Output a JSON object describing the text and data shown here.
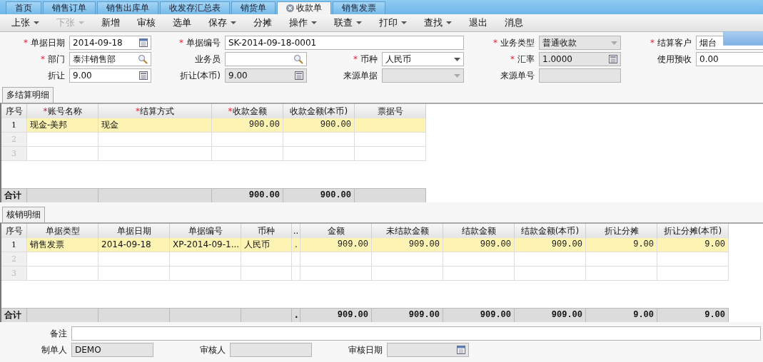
{
  "doc_tabs": [
    {
      "label": "首页",
      "selected": false
    },
    {
      "label": "销售订单",
      "selected": false
    },
    {
      "label": "销售出库单",
      "selected": false
    },
    {
      "label": "收发存汇总表",
      "selected": false
    },
    {
      "label": "销货单",
      "selected": false
    },
    {
      "label": "收款单",
      "selected": true
    },
    {
      "label": "销售发票",
      "selected": false
    }
  ],
  "toolbar": [
    {
      "label": "上张",
      "menu": true,
      "disabled": false
    },
    {
      "label": "下张",
      "menu": true,
      "disabled": true
    },
    {
      "label": "新增",
      "menu": false,
      "disabled": false
    },
    {
      "label": "审核",
      "menu": false,
      "disabled": false
    },
    {
      "label": "选单",
      "menu": false,
      "disabled": false
    },
    {
      "label": "保存",
      "menu": true,
      "disabled": false
    },
    {
      "label": "分摊",
      "menu": false,
      "disabled": false
    },
    {
      "label": "操作",
      "menu": true,
      "disabled": false
    },
    {
      "label": "联查",
      "menu": true,
      "disabled": false
    },
    {
      "label": "打印",
      "menu": true,
      "disabled": false
    },
    {
      "label": "查找",
      "menu": true,
      "disabled": false
    },
    {
      "label": "退出",
      "menu": false,
      "disabled": false
    },
    {
      "label": "消息",
      "menu": false,
      "disabled": false
    }
  ],
  "form": [
    {
      "mark": "*",
      "label": "单据日期",
      "kind": "date",
      "value": "2014-09-18",
      "disabled": false,
      "wide": false
    },
    {
      "mark": "*",
      "label": "单据编号",
      "kind": "plain",
      "value": "SK-2014-09-18-0001",
      "disabled": false,
      "wide": true
    },
    {
      "mark": "*",
      "label": "业务类型",
      "kind": "dropdown",
      "value": "普通收款",
      "disabled": true,
      "wide": false
    },
    {
      "mark": "*",
      "label": "结算客户",
      "kind": "covered",
      "value": "烟台",
      "disabled": false,
      "wide": false
    },
    {
      "mark": "*",
      "label": "部门",
      "kind": "search",
      "value": "泰沣销售部",
      "disabled": false,
      "wide": false
    },
    {
      "label": "业务员",
      "kind": "search",
      "disabled": false,
      "wide": false
    },
    {
      "mark": "*",
      "label": "币种",
      "kind": "dropdown",
      "value": "人民币",
      "disabled": false,
      "wide": false
    },
    {
      "mark": "*",
      "label": "汇率",
      "kind": "calc",
      "value": "1.0000",
      "disabled": true,
      "wide": false
    },
    {
      "label": "使用预收",
      "kind": "plain",
      "value": "0.00",
      "disabled": false,
      "wide": false
    },
    {
      "label": "折让",
      "kind": "calc",
      "value": "9.00",
      "disabled": false,
      "wide": false
    },
    {
      "label": "折让(本币)",
      "kind": "calc",
      "value": "9.00",
      "disabled": true,
      "wide": false
    },
    {
      "label": "来源单据",
      "kind": "dropdown",
      "disabled": true,
      "wide": false
    },
    {
      "label": "来源单号",
      "kind": "plain",
      "disabled": true,
      "wide": false
    }
  ],
  "grids": [
    {
      "tab": "多结算明细",
      "columns": [
        {
          "label": "序号"
        },
        {
          "mark": "*",
          "label": "账号名称"
        },
        {
          "mark": "*",
          "label": "结算方式"
        },
        {
          "mark": "*",
          "label": "收款金额"
        },
        {
          "label": "收款金额(本币)"
        },
        {
          "label": "票据号"
        }
      ],
      "rows": [
        {
          "cells": [
            "1",
            "现金-美邦",
            "现金",
            "900.00",
            "900.00"
          ],
          "selected": true
        },
        {
          "cells": [
            "2"
          ],
          "selected": false
        },
        {
          "cells": [
            "3"
          ],
          "selected": false
        },
        {
          "kind": "total",
          "cells": [
            "合计",
            null,
            null,
            "900.00",
            "900.00"
          ]
        }
      ]
    },
    {
      "tab": "核销明细",
      "columns": [
        {
          "label": "序号"
        },
        {
          "label": "单据类型"
        },
        {
          "label": "单据日期"
        },
        {
          "label": "单据编号"
        },
        {
          "label": "币种"
        },
        {
          "label": ".."
        },
        {
          "label": "金额"
        },
        {
          "label": "未结款金额"
        },
        {
          "label": "结款金额"
        },
        {
          "label": "结款金额(本币)"
        },
        {
          "label": "折让分摊"
        },
        {
          "label": "折让分摊(本币)"
        }
      ],
      "rows": [
        {
          "cells": [
            "1",
            "销售发票",
            "2014-09-18",
            "XP-2014-09-1...",
            "人民币",
            ".",
            "909.00",
            "909.00",
            "909.00",
            "909.00",
            "9.00",
            "9.00"
          ],
          "selected": true
        },
        {
          "cells": [
            "2"
          ],
          "selected": false
        },
        {
          "cells": [
            "3"
          ],
          "selected": false
        },
        {
          "kind": "total",
          "cells": [
            "合计",
            null,
            null,
            null,
            null,
            ".",
            "909.00",
            "909.00",
            "909.00",
            "909.00",
            "9.00",
            "9.00"
          ]
        }
      ]
    }
  ],
  "footer": [
    {
      "label": "备注",
      "kind": "plain",
      "disabled": false,
      "wide": true
    },
    {
      "label": "制单人",
      "kind": "plain",
      "value": "DEMO",
      "disabled": true,
      "wide": false
    },
    {
      "label": "审核人",
      "kind": "plain",
      "disabled": true,
      "wide": false
    },
    {
      "label": "审核日期",
      "kind": "date",
      "disabled": true,
      "wide": false
    }
  ]
}
